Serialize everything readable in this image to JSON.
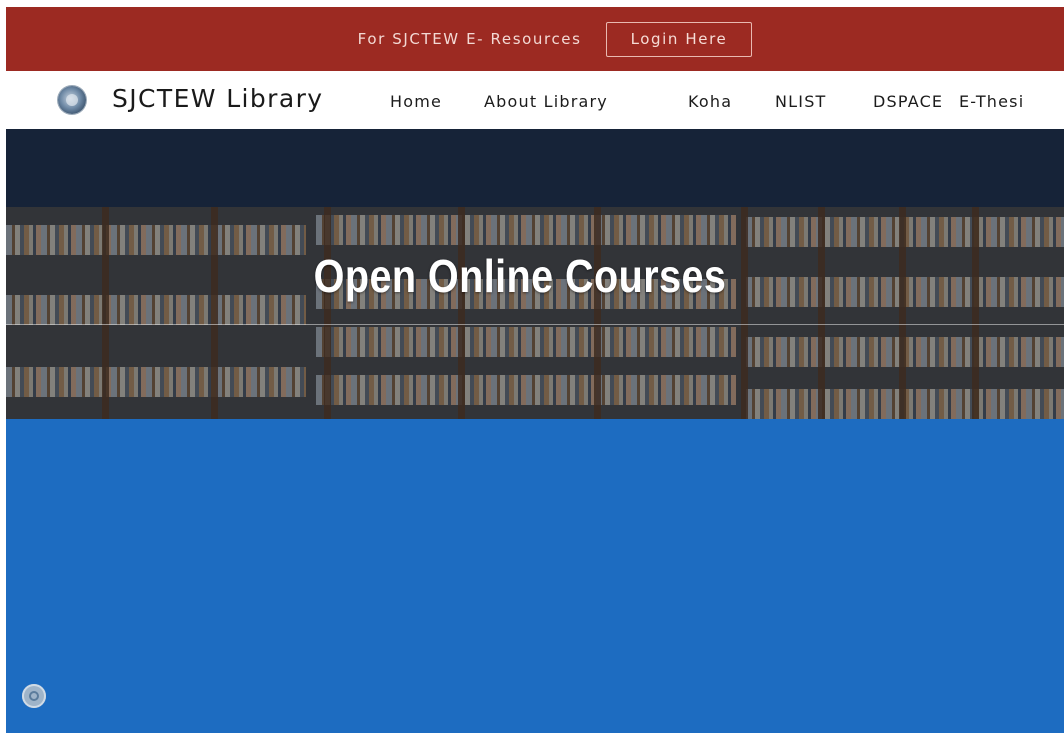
{
  "topbar": {
    "text": "For SJCTEW E- Resources",
    "login_label": "Login Here"
  },
  "navbar": {
    "brand": "SJCTEW Library",
    "items": [
      {
        "label": "Home"
      },
      {
        "label": "About Library"
      },
      {
        "label": "Koha"
      },
      {
        "label": "NLIST"
      },
      {
        "label": "DSPACE"
      },
      {
        "label": "E-Thesi"
      }
    ]
  },
  "hero": {
    "title": "Open Online Courses"
  },
  "colors": {
    "topbar": "#9c2a22",
    "dark_band": "#162338",
    "blue_area": "#1d6cc1"
  },
  "icons": {
    "logo": "library-logo-icon",
    "accessibility": "accessibility-icon"
  }
}
